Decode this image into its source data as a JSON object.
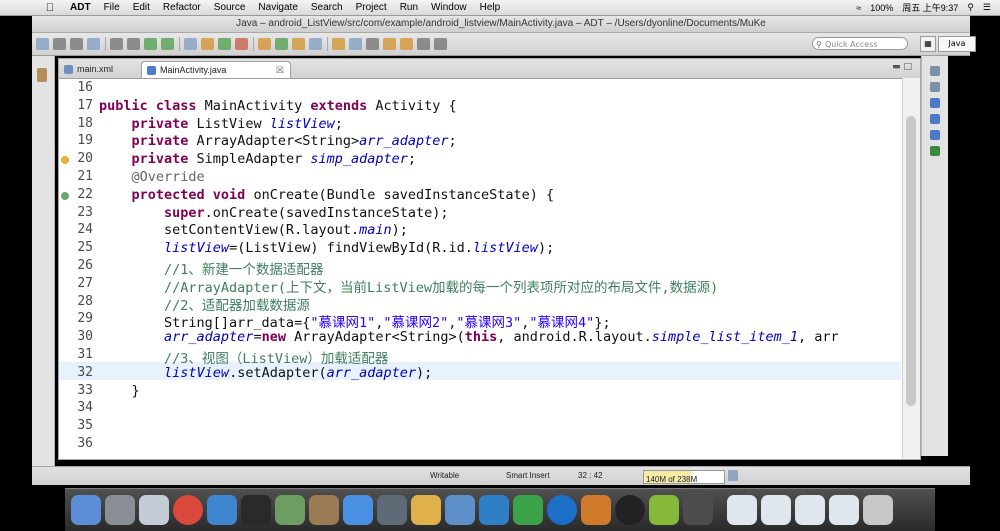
{
  "menubar": {
    "apple": "",
    "app": "ADT",
    "menus": [
      "File",
      "Edit",
      "Refactor",
      "Source",
      "Navigate",
      "Search",
      "Project",
      "Run",
      "Window",
      "Help"
    ],
    "battery": "100%",
    "clock": "周五 上午9:37"
  },
  "window": {
    "title": "Java – android_ListView/src/com/example/android_listview/MainActivity.java – ADT – /Users/dyonline/Documents/MuKe"
  },
  "toolbar": {
    "quick_access_placeholder": "Quick Access",
    "perspective": "Java"
  },
  "tabs": [
    {
      "label": "main.xml"
    },
    {
      "label": "MainActivity.java",
      "close": "☒"
    }
  ],
  "editor": {
    "lines": [
      {
        "n": "16",
        "html": ""
      },
      {
        "n": "17",
        "html": "<span class=\"kw\">public class</span> MainActivity <span class=\"kw\">extends</span> Activity {"
      },
      {
        "n": "18",
        "html": "    <span class=\"kw\">private</span> ListView <span class=\"fld\">listView</span>;"
      },
      {
        "n": "19",
        "html": "    <span class=\"kw\">private</span> ArrayAdapter&lt;String&gt;<span class=\"fld\">arr_adapter</span>;"
      },
      {
        "n": "20",
        "html": "    <span class=\"kw\">private</span> SimpleAdapter <span class=\"fld\">simp_adapter</span>;"
      },
      {
        "n": "21",
        "html": "    <span class=\"an\">@Override</span>"
      },
      {
        "n": "22",
        "html": "    <span class=\"kw\">protected void</span> onCreate(Bundle savedInstanceState) {"
      },
      {
        "n": "23",
        "html": "        <span class=\"kw\">super</span>.onCreate(savedInstanceState);"
      },
      {
        "n": "24",
        "html": "        setContentView(R.layout.<span class=\"fld\">main</span>);"
      },
      {
        "n": "25",
        "html": "        <span class=\"fld\">listView</span>=(ListView) findViewById(R.id.<span class=\"fld\">listView</span>);"
      },
      {
        "n": "26",
        "html": "        <span class=\"cm\">//1、新建一个数据适配器</span>"
      },
      {
        "n": "27",
        "html": "        <span class=\"cm\">//ArrayAdapter(上下文，当前ListView加载的每一个列表项所对应的布局文件,数据源)</span>"
      },
      {
        "n": "28",
        "html": "        <span class=\"cm\">//2、适配器加载数据源</span>"
      },
      {
        "n": "29",
        "html": "        String[]arr_data={<span class=\"str\">\"慕课网1\"</span>,<span class=\"str\">\"慕课网2\"</span>,<span class=\"str\">\"慕课网3\"</span>,<span class=\"str\">\"慕课网4\"</span>};"
      },
      {
        "n": "30",
        "html": "        <span class=\"fld\">arr_adapter</span>=<span class=\"kw\">new</span> ArrayAdapter&lt;String&gt;(<span class=\"kw\">this</span>, android.R.layout.<span class=\"fld\">simple_list_item_1</span>, arr"
      },
      {
        "n": "31",
        "html": "        <span class=\"cm\">//3、视图（ListView）加载适配器</span>"
      },
      {
        "n": "32",
        "html": "        <span class=\"fld\">listView</span>.setAdapter(<span class=\"fld\">arr_adapter</span>);"
      },
      {
        "n": "33",
        "html": "    }"
      },
      {
        "n": "34",
        "html": ""
      },
      {
        "n": "35",
        "html": ""
      },
      {
        "n": "36",
        "html": ""
      }
    ]
  },
  "status": {
    "writable": "Writable",
    "insert_mode": "Smart Insert",
    "position": "32 : 42",
    "heap": "140M of 238M",
    "heap_used_fraction": 0.59
  }
}
